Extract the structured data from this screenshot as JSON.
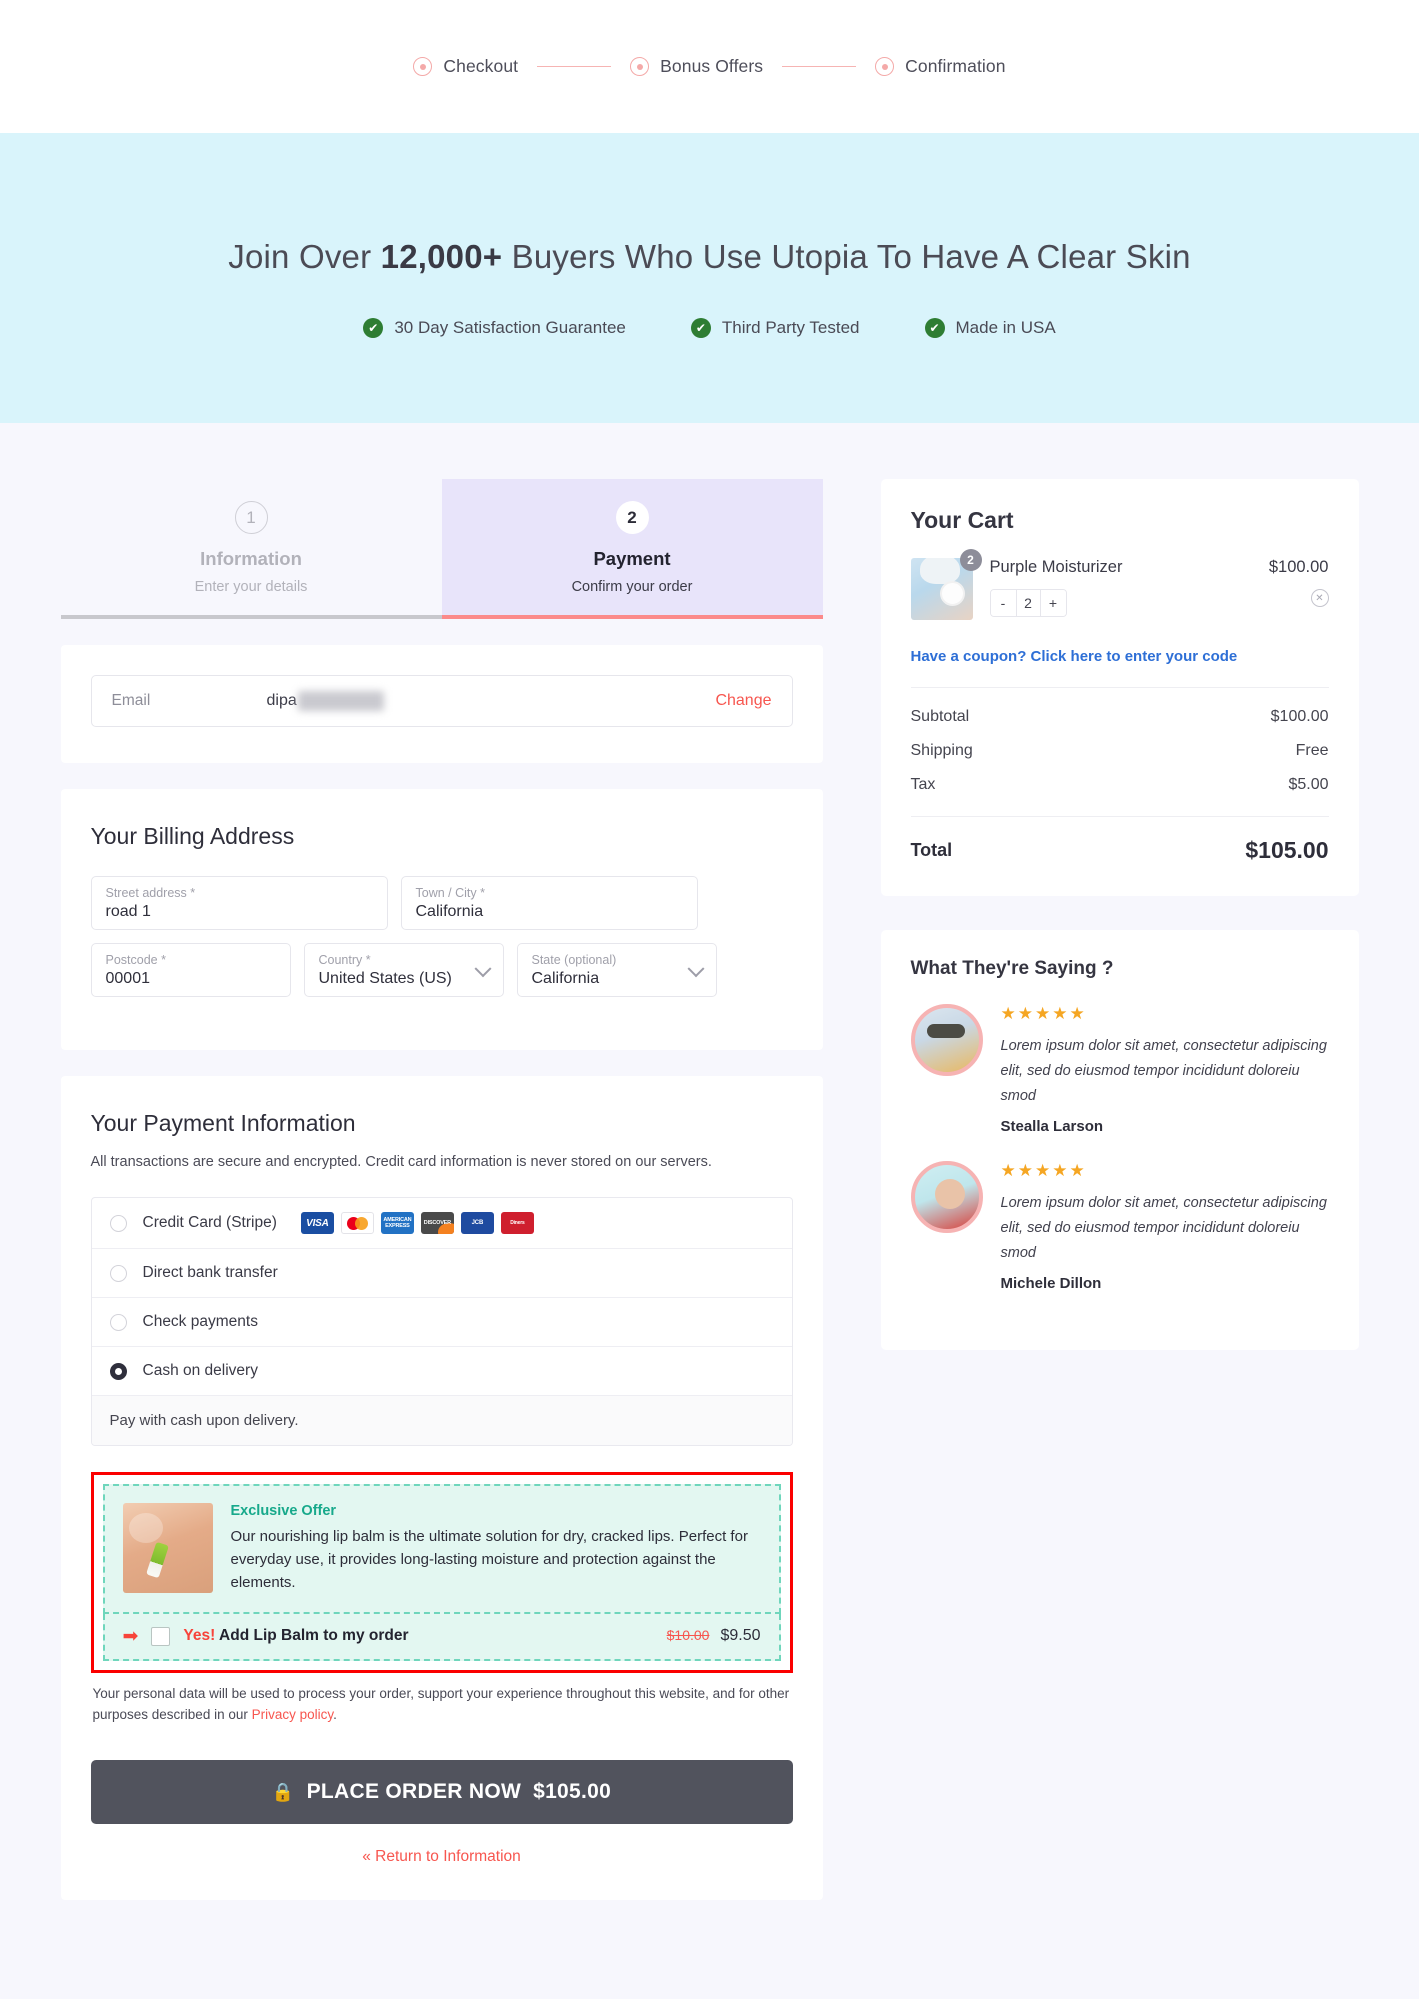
{
  "progress": {
    "steps": [
      {
        "label": "Checkout"
      },
      {
        "label": "Bonus Offers"
      },
      {
        "label": "Confirmation"
      }
    ]
  },
  "hero": {
    "title_pre": "Join Over ",
    "title_bold": "12,000+",
    "title_post": " Buyers Who Use Utopia To Have A Clear Skin",
    "badges": [
      {
        "icon": "check-circle-icon",
        "label": "30 Day Satisfaction Guarantee"
      },
      {
        "icon": "check-circle-icon",
        "label": "Third Party Tested"
      },
      {
        "icon": "check-circle-icon",
        "label": "Made in USA"
      }
    ]
  },
  "tabs": [
    {
      "number": "1",
      "title": "Information",
      "subtitle": "Enter your details",
      "active": false
    },
    {
      "number": "2",
      "title": "Payment",
      "subtitle": "Confirm your order",
      "active": true
    }
  ],
  "email": {
    "label": "Email",
    "value": "dipa",
    "change_label": "Change"
  },
  "billing": {
    "title": "Your Billing Address",
    "fields": [
      {
        "label": "Street address *",
        "value": "road 1",
        "type": "text"
      },
      {
        "label": "Town / City *",
        "value": "California",
        "type": "text"
      },
      {
        "label": "Postcode *",
        "value": "00001",
        "type": "text"
      },
      {
        "label": "Country *",
        "value": "United States (US)",
        "type": "select"
      },
      {
        "label": "State (optional)",
        "value": "California",
        "type": "select"
      }
    ]
  },
  "payment": {
    "title": "Your Payment Information",
    "description": "All transactions are secure and encrypted. Credit card information is never stored on our servers.",
    "methods": [
      {
        "label": "Credit Card (Stripe)",
        "selected": false,
        "cards": [
          "VISA",
          "mastercard",
          "AMERICAN EXPRESS",
          "DISCOVER",
          "JCB",
          "Diners Club"
        ]
      },
      {
        "label": "Direct bank transfer",
        "selected": false,
        "cards": []
      },
      {
        "label": "Check payments",
        "selected": false,
        "cards": []
      },
      {
        "label": "Cash on delivery",
        "selected": true,
        "cards": []
      }
    ],
    "note": "Pay with cash upon delivery."
  },
  "offer": {
    "heading": "Exclusive Offer",
    "text": "Our nourishing lip balm is the ultimate solution for dry, cracked lips. Perfect for everyday use, it provides long-lasting moisture and protection against the elements.",
    "accept_yes": "Yes!",
    "accept_rest": " Add Lip Balm to my order",
    "price_old": "$10.00",
    "price_new": "$9.50",
    "checked": false
  },
  "fineprint": {
    "text_before": "Your personal data will be used to process your order, support your experience throughout this website, and for other purposes described in our ",
    "link": "Privacy policy",
    "text_after": "."
  },
  "actions": {
    "place_order_label": "PLACE ORDER NOW",
    "place_order_amount": "$105.00",
    "return_link": "« Return to Information"
  },
  "cart": {
    "title": "Your Cart",
    "item": {
      "name": "Purple Moisturizer",
      "price": "$100.00",
      "quantity": "2",
      "badge_count": "2",
      "minus": "-",
      "plus": "+"
    },
    "coupon_link": "Have a coupon? Click here to enter your code",
    "summary": [
      {
        "label": "Subtotal",
        "value": "$100.00"
      },
      {
        "label": "Shipping",
        "value": "Free"
      },
      {
        "label": "Tax",
        "value": "$5.00"
      }
    ],
    "total": {
      "label": "Total",
      "value": "$105.00"
    }
  },
  "testimonials": {
    "title": "What They're Saying ?",
    "items": [
      {
        "stars": "★★★★★",
        "text": "Lorem ipsum dolor sit amet, consectetur adipiscing elit, sed do eiusmod tempor incididunt doloreiu smod",
        "name": "Stealla Larson"
      },
      {
        "stars": "★★★★★",
        "text": "Lorem ipsum dolor sit amet, consectetur adipiscing elit, sed do eiusmod tempor incididunt doloreiu smod",
        "name": "Michele Dillon"
      }
    ]
  },
  "colors": {
    "accent_red": "#f7564f",
    "hero_bg": "#d9f4fb",
    "page_bg": "#f7f7fd",
    "active_tab_bg": "#e8e4fa",
    "offer_border": "#fb0000",
    "offer_bg": "#e3f7f1",
    "button_bg": "#51535d",
    "coupon_blue": "#2e6fd6"
  }
}
